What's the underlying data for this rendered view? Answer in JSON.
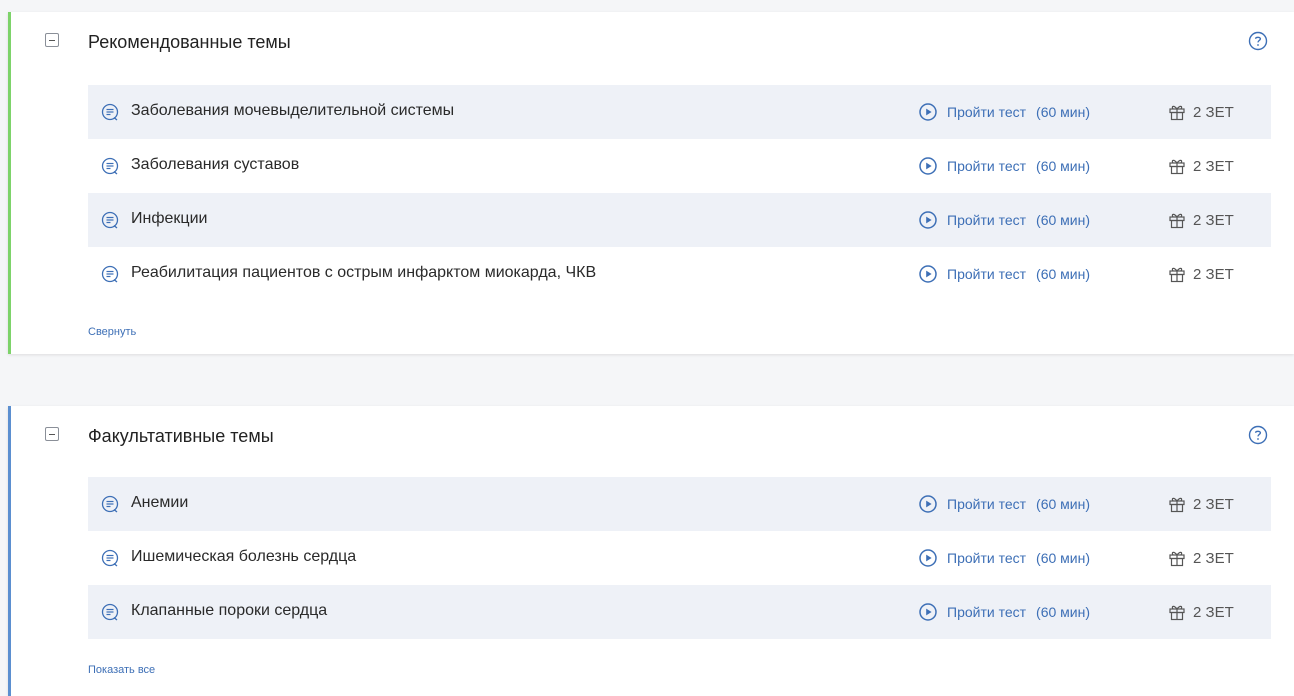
{
  "colors": {
    "recommended_accent": "#7dd36a",
    "optional_accent": "#5b8fd0",
    "link": "#3d6fb6",
    "row_shade": "#eef1f7"
  },
  "sections": [
    {
      "title": "Рекомендованные темы",
      "toggle_icon": "collapse-minus-icon",
      "help_icon": "question-circle-icon",
      "footer_link": "Свернуть",
      "items": [
        {
          "label": "Заболевания мочевыделительной системы",
          "action": "Пройти тест",
          "duration": "(60 мин)",
          "credits": "2 ЗЕТ",
          "icon": "topic-check-icon"
        },
        {
          "label": "Заболевания суставов",
          "action": "Пройти тест",
          "duration": "(60 мин)",
          "credits": "2 ЗЕТ",
          "icon": "topic-check-icon"
        },
        {
          "label": "Инфекции",
          "action": "Пройти тест",
          "duration": "(60 мин)",
          "credits": "2 ЗЕТ",
          "icon": "topic-check-icon"
        },
        {
          "label": "Реабилитация пациентов с острым инфарктом миокарда, ЧКВ",
          "action": "Пройти тест",
          "duration": "(60 мин)",
          "credits": "2 ЗЕТ",
          "icon": "topic-info-icon"
        }
      ]
    },
    {
      "title": "Факультативные темы",
      "toggle_icon": "collapse-minus-icon",
      "help_icon": "question-circle-icon",
      "footer_link": "Показать все",
      "items": [
        {
          "label": "Анемии",
          "action": "Пройти тест",
          "duration": "(60 мин)",
          "credits": "2 ЗЕТ",
          "icon": "topic-info-icon"
        },
        {
          "label": "Ишемическая болезнь сердца",
          "action": "Пройти тест",
          "duration": "(60 мин)",
          "credits": "2 ЗЕТ",
          "icon": "topic-info-icon"
        },
        {
          "label": "Клапанные пороки сердца",
          "action": "Пройти тест",
          "duration": "(60 мин)",
          "credits": "2 ЗЕТ",
          "icon": "topic-info-icon"
        }
      ]
    }
  ]
}
